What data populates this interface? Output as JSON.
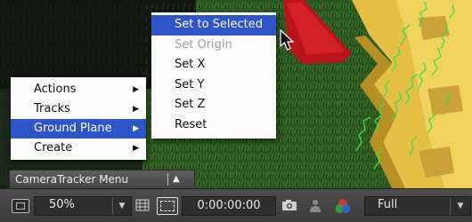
{
  "main_menu": {
    "items": [
      {
        "label": "Actions",
        "arrow": "▶"
      },
      {
        "label": "Tracks",
        "arrow": "▶"
      },
      {
        "label": "Ground Plane",
        "arrow": "▶"
      },
      {
        "label": "Create",
        "arrow": "▶"
      }
    ],
    "selected": "Ground Plane"
  },
  "sub_menu": {
    "items": [
      {
        "label": "Set to Selected"
      },
      {
        "label": "Set Origin"
      },
      {
        "label": "Set X"
      },
      {
        "label": "Set Y"
      },
      {
        "label": "Set Z"
      },
      {
        "label": "Reset"
      }
    ],
    "selected": "Set to Selected",
    "disabled": [
      "Set Origin"
    ]
  },
  "camera_tracker_bar": {
    "label": "CameraTracker Menu",
    "arrow": "▲"
  },
  "toolbar": {
    "zoom": "50%",
    "zoom_caret": "▼",
    "timecode": "0:00:00:00",
    "resolution": "Full",
    "resolution_caret": "▼"
  },
  "colors": {
    "selection": "#2d55c8",
    "menu_bg": "#fbfbfb",
    "track_green": "#39e04b",
    "toy_yellow": "#e9c84a",
    "toy_red": "#c1121a",
    "grass": "#2f5a24"
  },
  "icons": [
    "monitor-icon",
    "grid-icon",
    "region-of-interest-icon",
    "camera-icon",
    "person-icon",
    "channels-icon",
    "mouse-pointer-icon"
  ]
}
